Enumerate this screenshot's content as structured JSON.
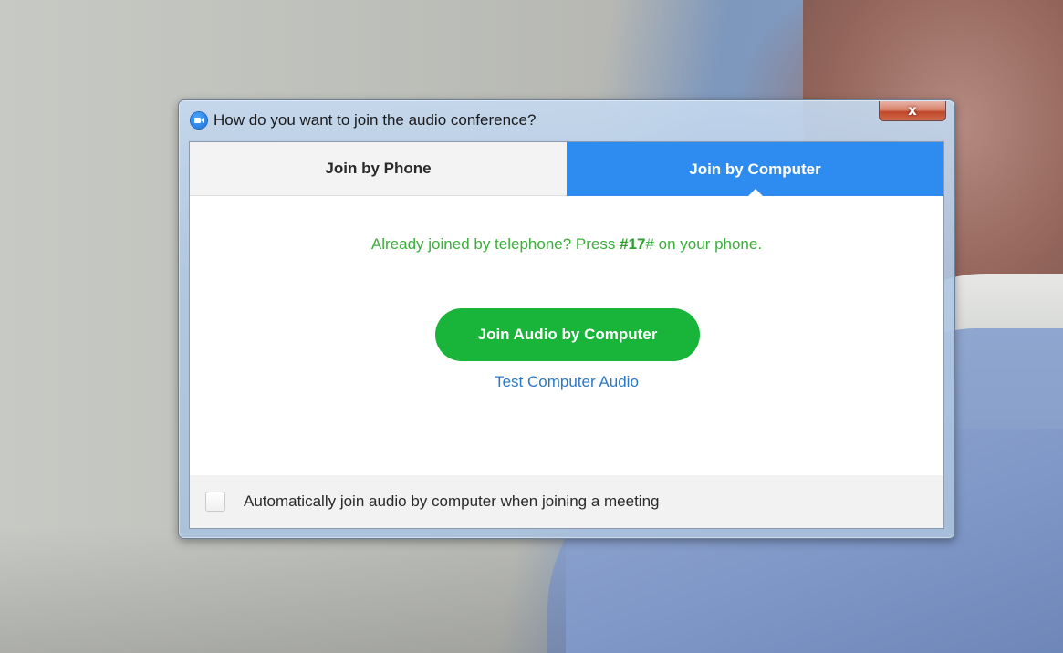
{
  "window": {
    "title": "How do you want to join the audio conference?",
    "close_label": "x"
  },
  "tabs": [
    {
      "label": "Join by Phone",
      "selected": false
    },
    {
      "label": "Join by Computer",
      "selected": true
    }
  ],
  "main": {
    "already_prefix": "Already joined by telephone? Press ",
    "already_code": "#17",
    "already_suffix": "# on your phone.",
    "join_button_label": "Join Audio by Computer",
    "test_link_label": "Test Computer Audio"
  },
  "footer": {
    "checkbox_label": "Automatically join audio by computer when joining a meeting",
    "checkbox_checked": false
  },
  "colors": {
    "accent_blue": "#2e8cf0",
    "join_green": "#19b43a",
    "message_green": "#3cae3c",
    "link_blue": "#2b79c4"
  },
  "icons": {
    "app": "zoom-camera-icon",
    "close": "close-icon"
  }
}
